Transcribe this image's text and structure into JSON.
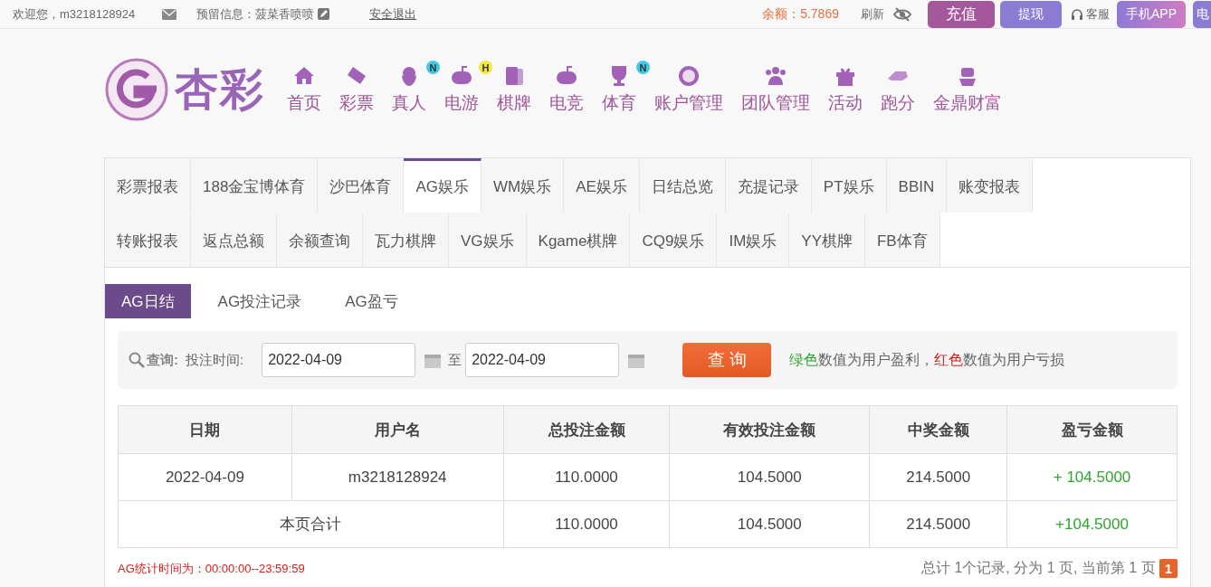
{
  "top_bar": {
    "welcome": "欢迎您，m3218128924",
    "reserved_info": "预留信息：菠菜香喷喷",
    "logout": "安全退出",
    "balance": "余额：5.7869",
    "refresh": "刷新",
    "buttons": [
      {
        "label": "充值",
        "kind": "deposit"
      },
      {
        "label": "提现",
        "kind": "withdraw"
      }
    ],
    "service": "客服",
    "app_button": "手机APP",
    "cut_button": "电"
  },
  "logo": {
    "text": "杏彩"
  },
  "nav": [
    {
      "label": "首页"
    },
    {
      "label": "彩票"
    },
    {
      "label": "真人",
      "badge": {
        "text": "N",
        "color": "#3fc8e8"
      }
    },
    {
      "label": "电游",
      "badge": {
        "text": "H",
        "color": "#f5e83a"
      }
    },
    {
      "label": "棋牌"
    },
    {
      "label": "电竞"
    },
    {
      "label": "体育",
      "badge": {
        "text": "N",
        "color": "#3fc8e8"
      }
    },
    {
      "label": "账户管理"
    },
    {
      "label": "团队管理"
    },
    {
      "label": "活动"
    },
    {
      "label": "跑分"
    },
    {
      "label": "金鼎财富"
    }
  ],
  "report_tabs": [
    [
      {
        "label": "彩票报表",
        "selected": false
      },
      {
        "label": "188金宝博体育",
        "selected": false
      },
      {
        "label": "沙巴体育",
        "selected": false
      },
      {
        "label": "AG娱乐",
        "selected": true
      },
      {
        "label": "WM娱乐",
        "selected": false
      },
      {
        "label": "AE娱乐",
        "selected": false
      },
      {
        "label": "日结总览",
        "selected": false
      },
      {
        "label": "充提记录",
        "selected": false
      },
      {
        "label": "PT娱乐",
        "selected": false
      },
      {
        "label": "BBIN",
        "selected": false
      },
      {
        "label": "账变报表",
        "selected": false
      }
    ],
    [
      {
        "label": "转账报表",
        "selected": false
      },
      {
        "label": "返点总额",
        "selected": false
      },
      {
        "label": "余额查询",
        "selected": false
      },
      {
        "label": "瓦力棋牌",
        "selected": false
      },
      {
        "label": "VG娱乐",
        "selected": false
      },
      {
        "label": "Kgame棋牌",
        "selected": false
      },
      {
        "label": "CQ9娱乐",
        "selected": false
      },
      {
        "label": "IM娱乐",
        "selected": false
      },
      {
        "label": "YY棋牌",
        "selected": false
      },
      {
        "label": "FB体育",
        "selected": false
      }
    ]
  ],
  "sub_tabs": [
    {
      "label": "AG日结",
      "selected": true
    },
    {
      "label": "AG投注记录",
      "selected": false
    },
    {
      "label": "AG盈亏",
      "selected": false
    }
  ],
  "query": {
    "label": "查询:",
    "time_label": "投注时间:",
    "from": "2022-04-09",
    "to_label": "至",
    "to": "2022-04-09",
    "button": "查 询",
    "legend": [
      {
        "text": "绿色",
        "kind": "profit"
      },
      {
        "text": "数值为用户盈利，",
        "kind": "plain"
      },
      {
        "text": "红色",
        "kind": "loss"
      },
      {
        "text": "数值为用户亏损",
        "kind": "plain"
      }
    ]
  },
  "table": {
    "columns": [
      "日期",
      "用户名",
      "总投注金额",
      "有效投注金额",
      "中奖金额",
      "盈亏金额"
    ],
    "rows": [
      {
        "cells": [
          "2022-04-09",
          "m3218128924",
          "110.0000",
          "104.5000",
          "214.5000",
          "+ 104.5000"
        ],
        "profit": true
      }
    ],
    "total": {
      "label": "本页合计",
      "cells": [
        "110.0000",
        "104.5000",
        "214.5000",
        "+104.5000"
      ],
      "profit": true
    }
  },
  "footer": {
    "note": "AG统计时间为：00:00:00--23:59:59",
    "summary": "总计 1个记录, 分为 1 页, 当前第 1 页",
    "current_page": "1"
  }
}
